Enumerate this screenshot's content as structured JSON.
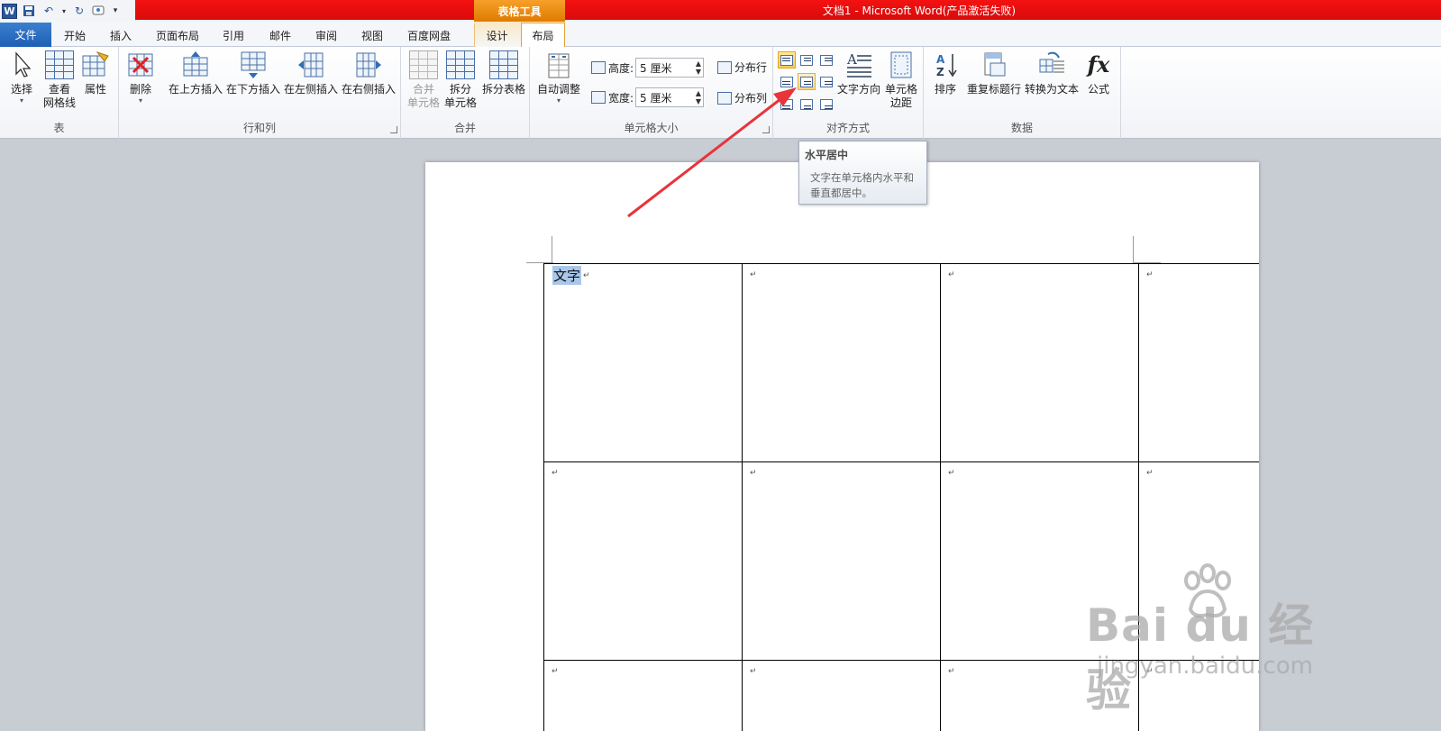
{
  "titlebar": {
    "context_tab_title": "表格工具",
    "window_title": "文档1 - Microsoft Word(产品激活失败)",
    "app_badge": "W"
  },
  "tabs": {
    "file": "文件",
    "home": "开始",
    "insert": "插入",
    "page_layout": "页面布局",
    "references": "引用",
    "mailings": "邮件",
    "review": "审阅",
    "view": "视图",
    "baidu": "百度网盘",
    "design": "设计",
    "layout": "布局"
  },
  "ribbon": {
    "table_group": {
      "label": "表",
      "select": "选择",
      "gridlines_1": "查看",
      "gridlines_2": "网格线",
      "properties": "属性"
    },
    "rows_cols_group": {
      "label": "行和列",
      "delete": "删除",
      "insert_above": "在上方插入",
      "insert_below": "在下方插入",
      "insert_left": "在左侧插入",
      "insert_right": "在右侧插入"
    },
    "merge_group": {
      "label": "合并",
      "merge_1": "合并",
      "merge_2": "单元格",
      "split_1": "拆分",
      "split_2": "单元格",
      "split_table": "拆分表格"
    },
    "cell_size_group": {
      "label": "单元格大小",
      "autofit": "自动调整",
      "height_label": "高度:",
      "height_value": "5 厘米",
      "width_label": "宽度:",
      "width_value": "5 厘米",
      "distribute_rows": "分布行",
      "distribute_cols": "分布列"
    },
    "alignment_group": {
      "label": "对齐方式",
      "text_direction": "文字方向",
      "margins_1": "单元格",
      "margins_2": "边距"
    },
    "data_group": {
      "label": "数据",
      "sort": "排序",
      "repeat_header": "重复标题行",
      "convert_text": "转换为文本",
      "formula": "公式",
      "fx": "fx"
    }
  },
  "tooltip": {
    "title": "水平居中",
    "body": "文字在单元格内水平和垂直都居中。"
  },
  "document": {
    "first_cell_text": "文字",
    "paragraph_mark": "↵"
  },
  "watermark": {
    "brand": "Bai du 经验",
    "url": "jingyan.baidu.com"
  },
  "colors": {
    "title_red": "#e60f0f",
    "context_orange": "#f08c10",
    "file_tab_blue": "#2b6cc4",
    "selection": "#a9c7ea",
    "arrow": "#e8343a"
  }
}
